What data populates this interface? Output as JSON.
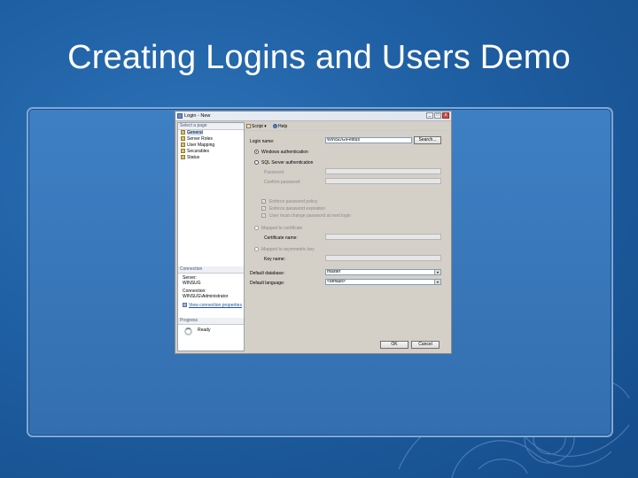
{
  "slide": {
    "title": "Creating Logins and Users Demo"
  },
  "dialog": {
    "title": "Login - New",
    "window_buttons": [
      "_",
      "□",
      "x"
    ],
    "left_pane": {
      "select_page_header": "Select a page",
      "pages": [
        "General",
        "Server Roles",
        "User Mapping",
        "Securables",
        "Status"
      ],
      "connection_header": "Connection",
      "server_label": "Server:",
      "server_value": "WINSUG",
      "connection_label": "Connection:",
      "connection_value": "WINSUG\\Administrator",
      "view_properties_link": "View connection properties",
      "progress_header": "Progress",
      "progress_status": "Ready"
    },
    "toolbar": {
      "script_label": "Script",
      "script_dropdown": "▾",
      "help_label": "Help"
    },
    "form": {
      "login_name_label": "Login name:",
      "login_name_value": "WINSUG\\Festus",
      "search_button": "Search...",
      "windows_auth_label": "Windows authentication",
      "sql_auth_label": "SQL Server authentication",
      "password_label": "Password:",
      "confirm_password_label": "Confirm password:",
      "enforce_policy_label": "Enforce password policy",
      "enforce_expiration_label": "Enforce password expiration",
      "must_change_label": "User must change password at next login",
      "mapped_cert_label": "Mapped to certificate",
      "cert_name_label": "Certificate name:",
      "mapped_key_label": "Mapped to asymmetric key",
      "key_name_label": "Key name:",
      "default_db_label": "Default database:",
      "default_db_value": "master",
      "default_lang_label": "Default language:",
      "default_lang_value": "<default>"
    },
    "footer": {
      "ok_button": "OK",
      "cancel_button": "Cancel"
    }
  },
  "colors": {
    "background": "#1f5fa3",
    "panel": "#3a79bd",
    "dialog": "#d4d0c8",
    "link": "#1f4fb3"
  }
}
